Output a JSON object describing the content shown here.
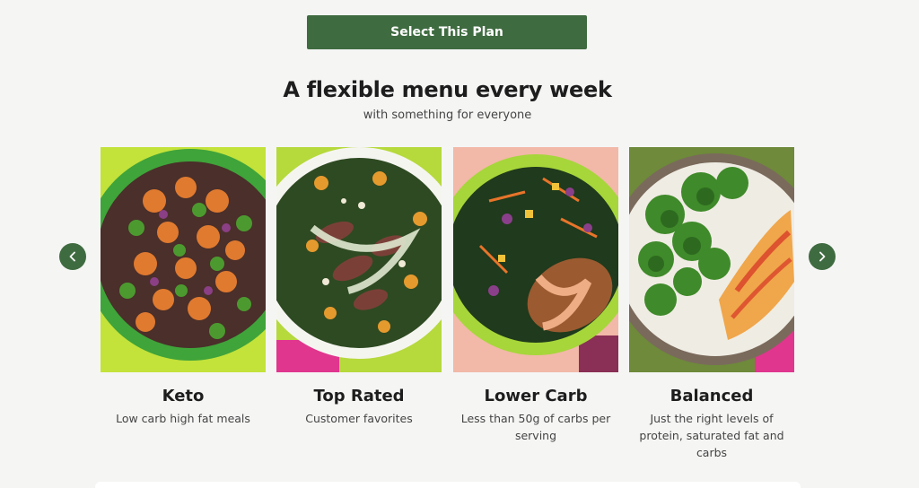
{
  "cta": {
    "label": "Select This Plan"
  },
  "section": {
    "headline": "A flexible menu every week",
    "subline": "with something for everyone"
  },
  "carousel": {
    "prev_icon": "chevron-left-icon",
    "next_icon": "chevron-right-icon",
    "cards": [
      {
        "title": "Keto",
        "description": "Low carb high fat meals"
      },
      {
        "title": "Top Rated",
        "description": "Customer favorites"
      },
      {
        "title": "Lower Carb",
        "description": "Less than 50g of carbs per serving"
      },
      {
        "title": "Balanced",
        "description": "Just the right levels of protein, saturated fat and carbs"
      }
    ]
  },
  "colors": {
    "brand_green": "#3f6b40",
    "background": "#f5f5f4"
  }
}
